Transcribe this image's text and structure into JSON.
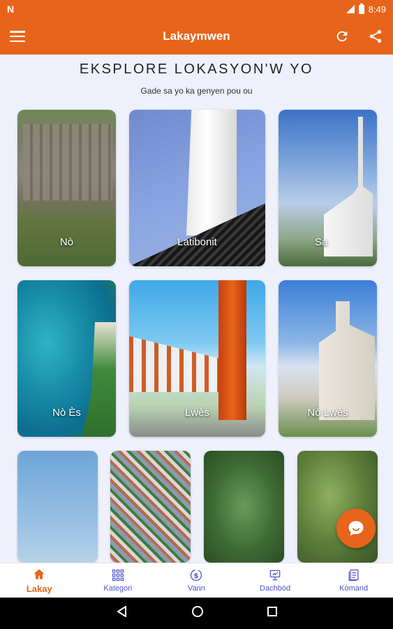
{
  "status_bar": {
    "left_icon": "N",
    "time": "8:49"
  },
  "app_bar": {
    "title": "Lakaymwen"
  },
  "explore": {
    "heading": "EKSPLORE LOKASYON'W YO",
    "subheading": "Gade sa yo ka genyen pou ou"
  },
  "locations": [
    {
      "label": "Nò"
    },
    {
      "label": "Latibonit"
    },
    {
      "label": "Sa"
    },
    {
      "label": "Nò Ès"
    },
    {
      "label": "Lwès"
    },
    {
      "label": "Nò Lwès"
    }
  ],
  "bottom_nav": [
    {
      "label": "Lakay",
      "icon": "home-icon",
      "active": true
    },
    {
      "label": "Kategori",
      "icon": "grid-icon",
      "active": false
    },
    {
      "label": "Vann",
      "icon": "dollar-cycle-icon",
      "active": false
    },
    {
      "label": "Dachbòd",
      "icon": "dashboard-icon",
      "active": false
    },
    {
      "label": "Kòmand",
      "icon": "orders-icon",
      "active": false
    }
  ],
  "colors": {
    "accent": "#e8641a",
    "nav_inactive": "#4b56c8",
    "background": "#eef1fb"
  }
}
